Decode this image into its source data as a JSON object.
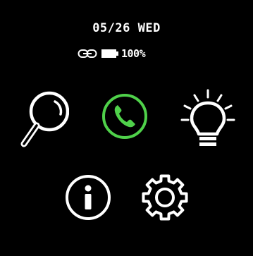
{
  "status": {
    "date": "05/26 WED",
    "battery_text": "100%"
  },
  "icons": {
    "link": "link-icon",
    "battery": "battery-full-icon",
    "search": "magnifier-icon",
    "phone": "phone-icon",
    "light": "lightbulb-icon",
    "info": "info-icon",
    "settings": "gear-icon"
  },
  "colors": {
    "background": "#000000",
    "foreground": "#ffffff",
    "phone_accent": "#4fd14a"
  }
}
